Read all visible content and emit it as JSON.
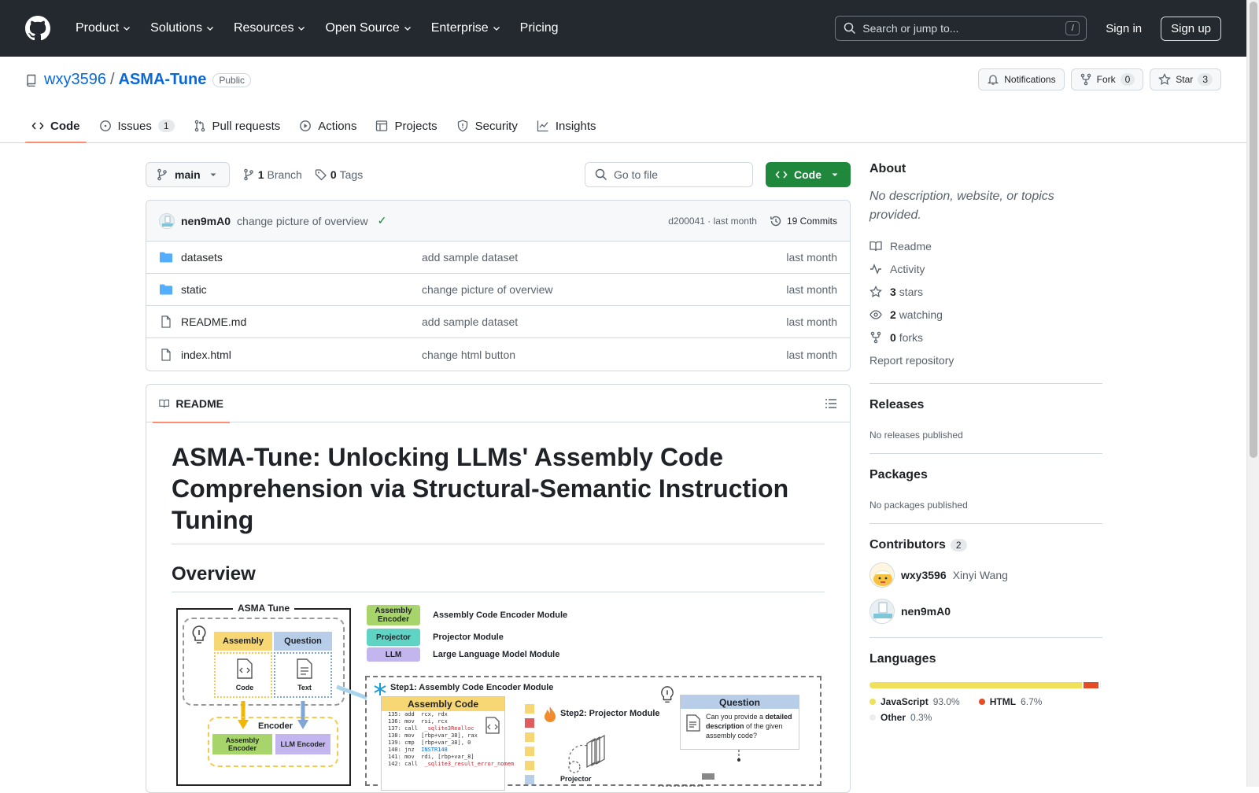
{
  "header": {
    "nav": [
      "Product",
      "Solutions",
      "Resources",
      "Open Source",
      "Enterprise",
      "Pricing"
    ],
    "search_placeholder": "Search or jump to...",
    "search_shortcut": "/",
    "sign_in": "Sign in",
    "sign_up": "Sign up"
  },
  "repo": {
    "owner": "wxy3596",
    "separator": "/",
    "name": "ASMA-Tune",
    "visibility": "Public",
    "notifications_label": "Notifications",
    "fork_label": "Fork",
    "fork_count": "0",
    "star_label": "Star",
    "star_count": "3"
  },
  "tabs": [
    {
      "label": "Code",
      "icon": "code-icon",
      "active": true
    },
    {
      "label": "Issues",
      "icon": "issue-icon",
      "count": "1"
    },
    {
      "label": "Pull requests",
      "icon": "pull-request-icon"
    },
    {
      "label": "Actions",
      "icon": "play-icon"
    },
    {
      "label": "Projects",
      "icon": "table-icon"
    },
    {
      "label": "Security",
      "icon": "shield-icon"
    },
    {
      "label": "Insights",
      "icon": "graph-icon"
    }
  ],
  "branchbar": {
    "branch": "main",
    "branch_count": "1",
    "branch_label": "Branch",
    "tag_count": "0",
    "tag_label": "Tags",
    "goto_placeholder": "Go to file",
    "code_button": "Code"
  },
  "latest_commit": {
    "author": "nen9mA0",
    "message": "change picture of overview",
    "check": "✓",
    "hash": "d200041",
    "dot": "·",
    "time": "last month",
    "commits": "19 Commits"
  },
  "files": [
    {
      "name": "datasets",
      "type": "folder",
      "message": "add sample dataset",
      "date": "last month"
    },
    {
      "name": "static",
      "type": "folder",
      "message": "change picture of overview",
      "date": "last month"
    },
    {
      "name": "README.md",
      "type": "file",
      "message": "add sample dataset",
      "date": "last month"
    },
    {
      "name": "index.html",
      "type": "file",
      "message": "change html button",
      "date": "last month"
    }
  ],
  "readme": {
    "tab": "README",
    "title": "ASMA-Tune: Unlocking LLMs' Assembly Code Comprehension via Structural-Semantic Instruction Tuning",
    "overview_heading": "Overview",
    "figure": {
      "asma_title": "ASMA Tune",
      "assembly": "Assembly",
      "question": "Question",
      "code": "Code",
      "text": "Text",
      "encoder": "Encoder",
      "assembly_encoder": "Assembly Encoder",
      "llm_encoder": "LLM Encoder",
      "legend": [
        {
          "swatch": "Assembly Encoder",
          "label": "Assembly Code Encoder Module",
          "color": "#a8d56b"
        },
        {
          "swatch": "Projector",
          "label": "Projector Module",
          "color": "#5fd3c4"
        },
        {
          "swatch": "LLM",
          "label": "Large Language Model Module",
          "color": "#c3b6ef"
        }
      ],
      "step1": "Step1: Assembly Code Encoder Module",
      "step2": "Step2: Projector Module",
      "assembly_code": "Assembly Code",
      "projector": "Projector",
      "question_text_1": "Can you provide a ",
      "question_text_bold": "detailed description",
      "question_text_2": " of the given assembly code?",
      "asm_lines": [
        {
          "addr": "135: add",
          "ops": "rcx, rdx",
          "tone": ""
        },
        {
          "addr": "136: mov",
          "ops": "rsi, rcx",
          "tone": ""
        },
        {
          "addr": "137: call",
          "ops": "_sqlite3Realloc",
          "tone": "hl"
        },
        {
          "addr": "138: mov",
          "ops": "[rbp+var_38], rax",
          "tone": ""
        },
        {
          "addr": "139: cmp",
          "ops": "[rbp+var_38], 0",
          "tone": ""
        },
        {
          "addr": "140: jnz",
          "ops": "INSTR148",
          "tone": "bl"
        },
        {
          "addr": "141: mov",
          "ops": "rdi, [rbp+var_8]",
          "tone": ""
        },
        {
          "addr": "142: call",
          "ops": "_sqlite3_result_error_nomem",
          "tone": "hl"
        }
      ]
    }
  },
  "about": {
    "heading": "About",
    "description": "No description, website, or topics provided.",
    "readme": "Readme",
    "activity": "Activity",
    "stars_count": "3",
    "stars_label": "stars",
    "watching_count": "2",
    "watching_label": "watching",
    "forks_count": "0",
    "forks_label": "forks",
    "report": "Report repository"
  },
  "releases": {
    "heading": "Releases",
    "text": "No releases published"
  },
  "packages": {
    "heading": "Packages",
    "text": "No packages published"
  },
  "contributors": {
    "heading": "Contributors",
    "count": "2",
    "people": [
      {
        "login": "wxy3596",
        "name": "Xinyi Wang"
      },
      {
        "login": "nen9mA0",
        "name": ""
      }
    ]
  },
  "languages": {
    "heading": "Languages",
    "items": [
      {
        "name": "JavaScript",
        "percent": "93.0%",
        "value": 93.0,
        "color": "#f1e05a"
      },
      {
        "name": "HTML",
        "percent": "6.7%",
        "value": 6.7,
        "color": "#e34c26"
      },
      {
        "name": "Other",
        "percent": "0.3%",
        "value": 0.3,
        "color": "#ededed"
      }
    ]
  },
  "colors": {
    "header_bg": "#24292f",
    "link": "#0969da",
    "primary_button": "#1f883d",
    "active_tab_underline": "#fd8c73"
  }
}
